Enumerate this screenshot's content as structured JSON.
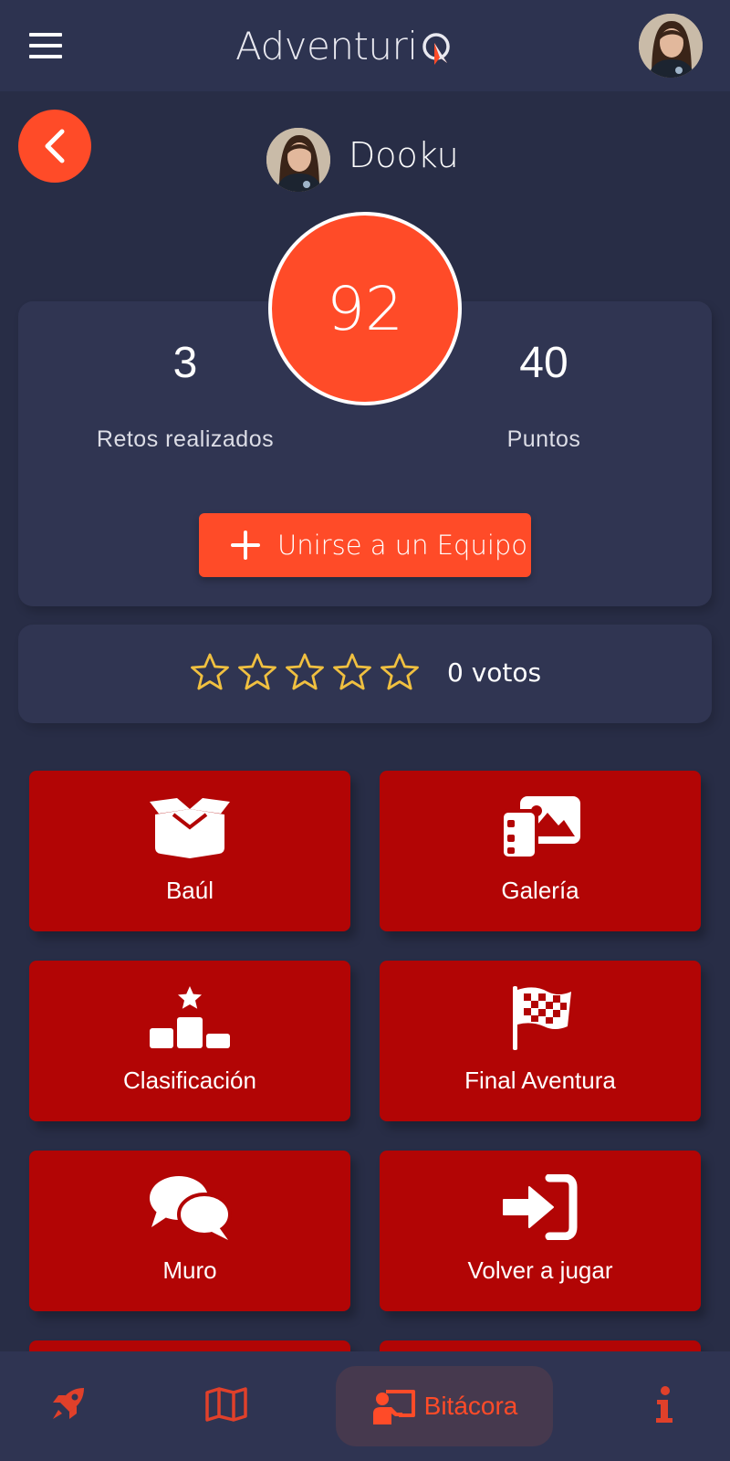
{
  "header": {
    "app_name": "Adventuri",
    "menu_icon": "hamburger-menu-icon"
  },
  "profile": {
    "name": "Dooku",
    "score": "92"
  },
  "stats": {
    "challenges_value": "3",
    "challenges_label": "Retos realizados",
    "points_value": "40",
    "points_label": "Puntos",
    "join_button": "Unirse a un Equipo"
  },
  "rating": {
    "stars_filled": 0,
    "stars_total": 5,
    "votes_label": "0 votos"
  },
  "tiles": [
    {
      "label": "Baúl",
      "icon": "open-box-icon"
    },
    {
      "label": "Galería",
      "icon": "gallery-images-icon"
    },
    {
      "label": "Clasificación",
      "icon": "podium-star-icon"
    },
    {
      "label": "Final Aventura",
      "icon": "checkered-flag-icon"
    },
    {
      "label": "Muro",
      "icon": "chat-bubbles-icon"
    },
    {
      "label": "Volver a jugar",
      "icon": "sign-in-arrow-icon"
    }
  ],
  "bottom_nav": {
    "items": [
      {
        "icon": "rocket-icon"
      },
      {
        "icon": "map-icon"
      },
      {
        "icon": "chalkboard-user-icon",
        "label": "Bitácora",
        "active": true
      },
      {
        "icon": "info-icon"
      }
    ]
  },
  "colors": {
    "background": "#282d46",
    "card": "#303552",
    "accent": "#ff4b28",
    "tile": "#b20505",
    "star": "#f0c040"
  }
}
